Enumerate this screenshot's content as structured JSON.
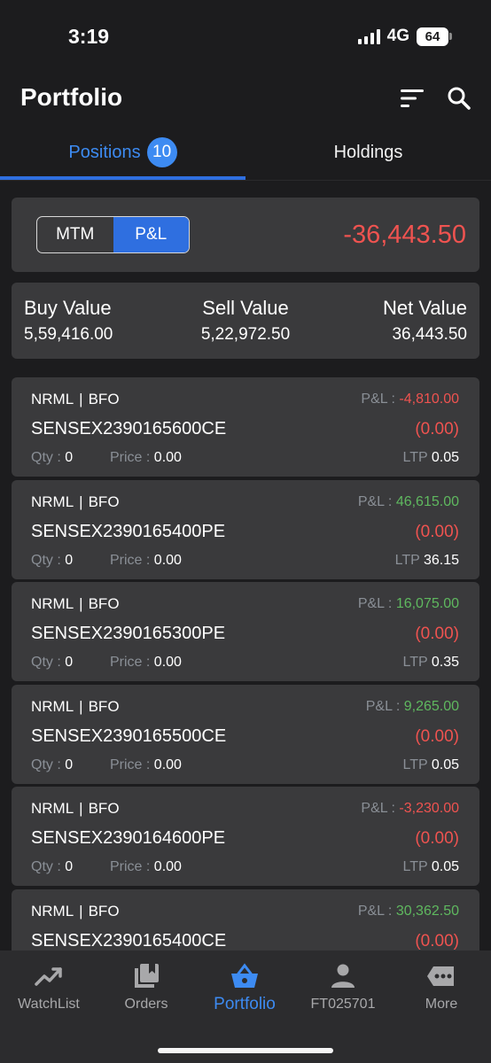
{
  "status_bar": {
    "time": "3:19",
    "network": "4G",
    "battery": "64"
  },
  "header": {
    "title": "Portfolio"
  },
  "tabs": {
    "positions_label": "Positions",
    "positions_count": "10",
    "holdings_label": "Holdings"
  },
  "toggle": {
    "mtm_label": "MTM",
    "pnl_label": "P&L",
    "active": "P&L",
    "total": "-36,443.50"
  },
  "summary": {
    "buy_label": "Buy Value",
    "buy_value": "5,59,416.00",
    "sell_label": "Sell Value",
    "sell_value": "5,22,972.50",
    "net_label": "Net Value",
    "net_value": "36,443.50"
  },
  "labels": {
    "pnl": "P&L :",
    "qty": "Qty :",
    "price": "Price :",
    "ltp": "LTP"
  },
  "positions": [
    {
      "product": "NRML",
      "exchange": "BFO",
      "symbol": "SENSEX2390165600CE",
      "pnl": "-4,810.00",
      "pnl_sign": "neg",
      "change": "(0.00)",
      "qty": "0",
      "price": "0.00",
      "ltp": "0.05"
    },
    {
      "product": "NRML",
      "exchange": "BFO",
      "symbol": "SENSEX2390165400PE",
      "pnl": "46,615.00",
      "pnl_sign": "pos",
      "change": "(0.00)",
      "qty": "0",
      "price": "0.00",
      "ltp": "36.15"
    },
    {
      "product": "NRML",
      "exchange": "BFO",
      "symbol": "SENSEX2390165300PE",
      "pnl": "16,075.00",
      "pnl_sign": "pos",
      "change": "(0.00)",
      "qty": "0",
      "price": "0.00",
      "ltp": "0.35"
    },
    {
      "product": "NRML",
      "exchange": "BFO",
      "symbol": "SENSEX2390165500CE",
      "pnl": "9,265.00",
      "pnl_sign": "pos",
      "change": "(0.00)",
      "qty": "0",
      "price": "0.00",
      "ltp": "0.05"
    },
    {
      "product": "NRML",
      "exchange": "BFO",
      "symbol": "SENSEX2390164600PE",
      "pnl": "-3,230.00",
      "pnl_sign": "neg",
      "change": "(0.00)",
      "qty": "0",
      "price": "0.00",
      "ltp": "0.05"
    },
    {
      "product": "NRML",
      "exchange": "BFO",
      "symbol": "SENSEX2390165400CE",
      "pnl": "30,362.50",
      "pnl_sign": "pos",
      "change": "(0.00)",
      "qty": "",
      "price": "",
      "ltp": ""
    }
  ],
  "bottom_nav": {
    "items": [
      {
        "label": "WatchList",
        "icon": "trending-up-icon"
      },
      {
        "label": "Orders",
        "icon": "book-icon"
      },
      {
        "label": "Portfolio",
        "icon": "basket-icon",
        "active": true
      },
      {
        "label": "FT025701",
        "icon": "person-icon"
      },
      {
        "label": "More",
        "icon": "more-icon"
      }
    ]
  },
  "colors": {
    "accent": "#2f6fe0",
    "negative": "#ef5350",
    "positive": "#5fb85f",
    "background": "#1c1c1e",
    "card": "#3a3a3c"
  }
}
